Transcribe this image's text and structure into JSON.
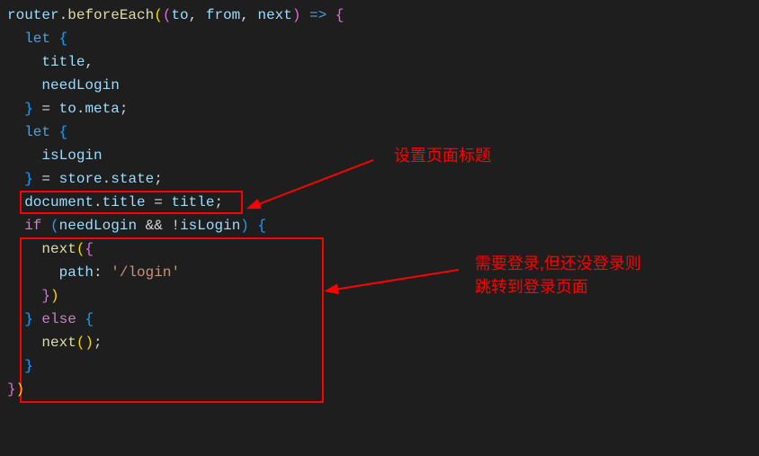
{
  "code": {
    "l1": {
      "t1": "router",
      "t2": ".",
      "t3": "beforeEach",
      "t4": "(",
      "t5": "(",
      "t6": "to",
      "t7": ", ",
      "t8": "from",
      "t9": ", ",
      "t10": "next",
      "t11": ")",
      "t12": " ",
      "t13": "=>",
      "t14": " ",
      "t15": "{"
    },
    "l2": {
      "t1": "  ",
      "t2": "let",
      "t3": " ",
      "t4": "{"
    },
    "l3": {
      "t1": "    ",
      "t2": "title",
      "t3": ","
    },
    "l4": {
      "t1": "    ",
      "t2": "needLogin"
    },
    "l5": {
      "t1": "  ",
      "t2": "}",
      "t3": " ",
      "t4": "=",
      "t5": " ",
      "t6": "to",
      "t7": ".",
      "t8": "meta",
      "t9": ";"
    },
    "l6": {
      "t1": "  ",
      "t2": "let",
      "t3": " ",
      "t4": "{"
    },
    "l7": {
      "t1": "    ",
      "t2": "isLogin"
    },
    "l8": {
      "t1": "  ",
      "t2": "}",
      "t3": " ",
      "t4": "=",
      "t5": " ",
      "t6": "store",
      "t7": ".",
      "t8": "state",
      "t9": ";"
    },
    "l9": {
      "t1": "  ",
      "t2": "document",
      "t3": ".",
      "t4": "title",
      "t5": " ",
      "t6": "=",
      "t7": " ",
      "t8": "title",
      "t9": ";"
    },
    "l10": {
      "t1": ""
    },
    "l11": {
      "t1": "  ",
      "t2": "if",
      "t3": " ",
      "t4": "(",
      "t5": "needLogin",
      "t6": " ",
      "t7": "&&",
      "t8": " ",
      "t9": "!",
      "t10": "isLogin",
      "t11": ")",
      "t12": " ",
      "t13": "{"
    },
    "l12": {
      "t1": "    ",
      "t2": "next",
      "t3": "(",
      "t4": "{"
    },
    "l13": {
      "t1": "      ",
      "t2": "path",
      "t3": ":",
      "t4": " ",
      "t5": "'/login'"
    },
    "l14": {
      "t1": "    ",
      "t2": "}",
      "t3": ")"
    },
    "l15": {
      "t1": "  ",
      "t2": "}",
      "t3": " ",
      "t4": "else",
      "t5": " ",
      "t6": "{"
    },
    "l16": {
      "t1": "    ",
      "t2": "next",
      "t3": "(",
      "t4": ")",
      "t5": ";"
    },
    "l17": {
      "t1": "  ",
      "t2": "}"
    },
    "l18": {
      "t1": "}",
      "t2": ")"
    }
  },
  "annotations": {
    "a1": "设置页面标题",
    "a2_line1": "需要登录,但还没登录则",
    "a2_line2": "跳转到登录页面"
  }
}
